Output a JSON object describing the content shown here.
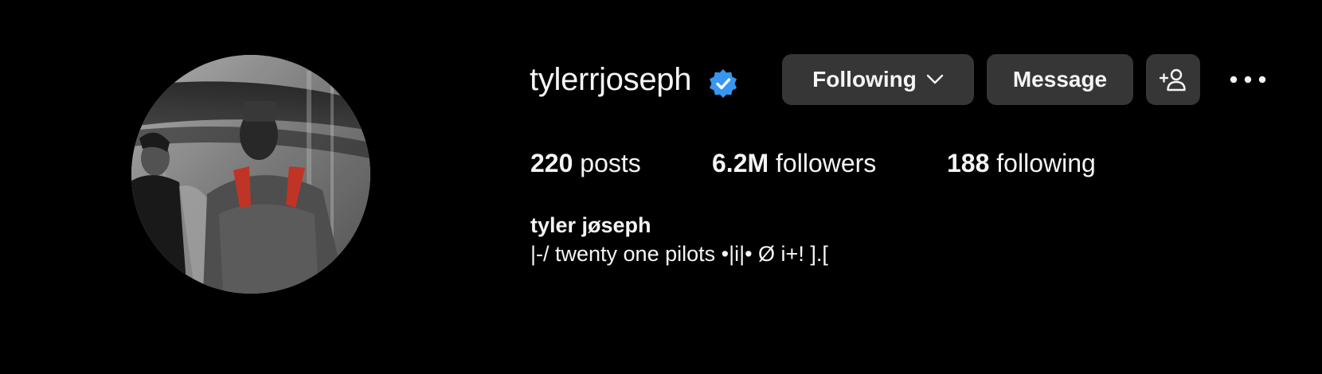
{
  "profile": {
    "username": "tylerrjoseph",
    "verified_icon": "verified-badge-icon",
    "verified_color": "#3797f0",
    "full_name": "tyler jøseph",
    "bio": "|-/ twenty one pilots •|i|• Ø i+! ].[",
    "avatar_description_icon": "profile-photo"
  },
  "actions": {
    "following_label": "Following",
    "message_label": "Message",
    "add_user_icon": "add-person-icon",
    "more_icon": "more-options-icon"
  },
  "stats": {
    "posts_count": "220",
    "posts_label": "posts",
    "followers_count": "6.2M",
    "followers_label": "followers",
    "following_count": "188",
    "following_label": "following"
  },
  "theme": {
    "background": "#000000",
    "button_bg": "#363636",
    "text": "#f5f5f5"
  }
}
